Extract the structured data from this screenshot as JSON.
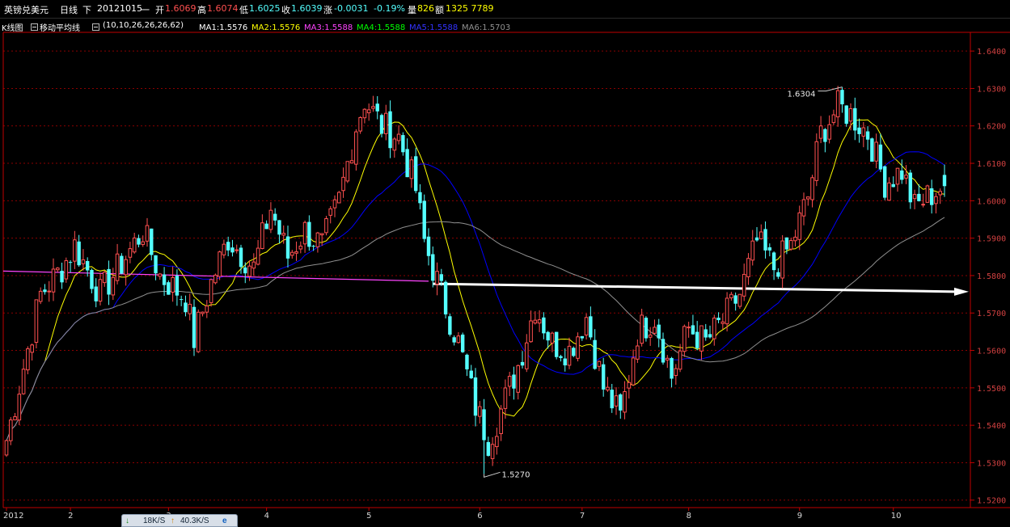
{
  "header": {
    "instrument": "英镑兑美元",
    "period": "日线",
    "direction": "下",
    "date": "20121015",
    "weekday": "一",
    "open_label": "开",
    "open_value": "1.6069",
    "high_label": "高",
    "high_value": "1.6074",
    "low_label": "低",
    "low_value": "1.6025",
    "close_label": "收",
    "close_value": "1.6039",
    "change_label": "涨",
    "change_value": "-0.0031",
    "change_pct": "-0.19%",
    "volume_label": "量",
    "volume_value": "826",
    "amount_label": "额",
    "amount_value": "1325 7789"
  },
  "ma_bar": {
    "kline_label": "K线图",
    "ma_title": "移动平均线",
    "params": "(10,10,26,26,26,62)",
    "items": [
      {
        "label": "MA1:1.5576",
        "color": "#ffffff"
      },
      {
        "label": "MA2:1.5576",
        "color": "#ffff00"
      },
      {
        "label": "MA3:1.5588",
        "color": "#ff44ff"
      },
      {
        "label": "MA4:1.5588",
        "color": "#00ff00"
      },
      {
        "label": "MA5:1.5588",
        "color": "#3333ff"
      },
      {
        "label": "MA6:1.5703",
        "color": "#909090"
      }
    ]
  },
  "status_bar": {
    "down_icon": "download-arrow-icon",
    "down_speed": "18K/S",
    "up_icon": "upload-arrow-icon",
    "up_speed": "40.3K/S",
    "browser_icon": "browser-icon"
  },
  "chart_data": {
    "type": "candlestick",
    "y_ticks": [
      "1.6400",
      "1.6300",
      "1.6200",
      "1.6100",
      "1.6000",
      "1.5900",
      "1.5800",
      "1.5700",
      "1.5600",
      "1.5500",
      "1.5400",
      "1.5300",
      "1.5200"
    ],
    "y_tick_values": [
      1.64,
      1.63,
      1.62,
      1.61,
      1.6,
      1.59,
      1.58,
      1.57,
      1.56,
      1.55,
      1.54,
      1.53,
      1.52
    ],
    "ylim": [
      1.518,
      1.645
    ],
    "x_labels": [
      {
        "label": "2012",
        "index": 0
      },
      {
        "label": "2",
        "index": 15
      },
      {
        "label": "3",
        "index": 38
      },
      {
        "label": "4",
        "index": 61
      },
      {
        "label": "5",
        "index": 85
      },
      {
        "label": "6",
        "index": 111
      },
      {
        "label": "7",
        "index": 135
      },
      {
        "label": "8",
        "index": 160
      },
      {
        "label": "9",
        "index": 186
      },
      {
        "label": "10",
        "index": 208
      }
    ],
    "candle_count": 221,
    "key_closes": [
      [
        0,
        1.536
      ],
      [
        8,
        1.575
      ],
      [
        13,
        1.582
      ],
      [
        16,
        1.588
      ],
      [
        22,
        1.575
      ],
      [
        28,
        1.585
      ],
      [
        32,
        1.592
      ],
      [
        36,
        1.58
      ],
      [
        42,
        1.574
      ],
      [
        44,
        1.563
      ],
      [
        48,
        1.578
      ],
      [
        52,
        1.59
      ],
      [
        58,
        1.582
      ],
      [
        62,
        1.598
      ],
      [
        66,
        1.585
      ],
      [
        70,
        1.592
      ],
      [
        74,
        1.588
      ],
      [
        78,
        1.6
      ],
      [
        82,
        1.62
      ],
      [
        84,
        1.627
      ],
      [
        88,
        1.62
      ],
      [
        92,
        1.617
      ],
      [
        96,
        1.603
      ],
      [
        98,
        1.589
      ],
      [
        102,
        1.575
      ],
      [
        106,
        1.562
      ],
      [
        110,
        1.545
      ],
      [
        113,
        1.536
      ],
      [
        116,
        1.544
      ],
      [
        120,
        1.556
      ],
      [
        124,
        1.572
      ],
      [
        128,
        1.562
      ],
      [
        132,
        1.56
      ],
      [
        136,
        1.569
      ],
      [
        140,
        1.55
      ],
      [
        144,
        1.542
      ],
      [
        148,
        1.565
      ],
      [
        152,
        1.569
      ],
      [
        156,
        1.553
      ],
      [
        160,
        1.566
      ],
      [
        164,
        1.562
      ],
      [
        168,
        1.568
      ],
      [
        172,
        1.575
      ],
      [
        176,
        1.589
      ],
      [
        180,
        1.582
      ],
      [
        184,
        1.588
      ],
      [
        188,
        1.601
      ],
      [
        191,
        1.618
      ],
      [
        195,
        1.625
      ],
      [
        198,
        1.623
      ],
      [
        202,
        1.618
      ],
      [
        206,
        1.605
      ],
      [
        210,
        1.608
      ],
      [
        213,
        1.598
      ],
      [
        216,
        1.601
      ],
      [
        220,
        1.604
      ]
    ],
    "series": [
      {
        "name": "MA1",
        "color": "#ffff00"
      },
      {
        "name": "MA2",
        "color": "#0000ff"
      },
      {
        "name": "MA6",
        "color": "#909090"
      }
    ],
    "trendline": {
      "color": "#ff44ff",
      "x1": 0,
      "y1": 1.5812,
      "x2": 99,
      "y2": 1.5785
    },
    "arrow": {
      "color": "#ffffff",
      "x1": 100,
      "y1": 1.5778,
      "x2": 220,
      "y2": 1.5757
    },
    "annotations": [
      {
        "label": "1.6304",
        "index": 196,
        "value": 1.6304,
        "position": "top-left"
      },
      {
        "label": "1.5270",
        "index": 112,
        "value": 1.527,
        "position": "bottom-right"
      }
    ],
    "up_color": "#ff5050",
    "down_color": "#54ffff",
    "grid_color": "#8b0000"
  }
}
